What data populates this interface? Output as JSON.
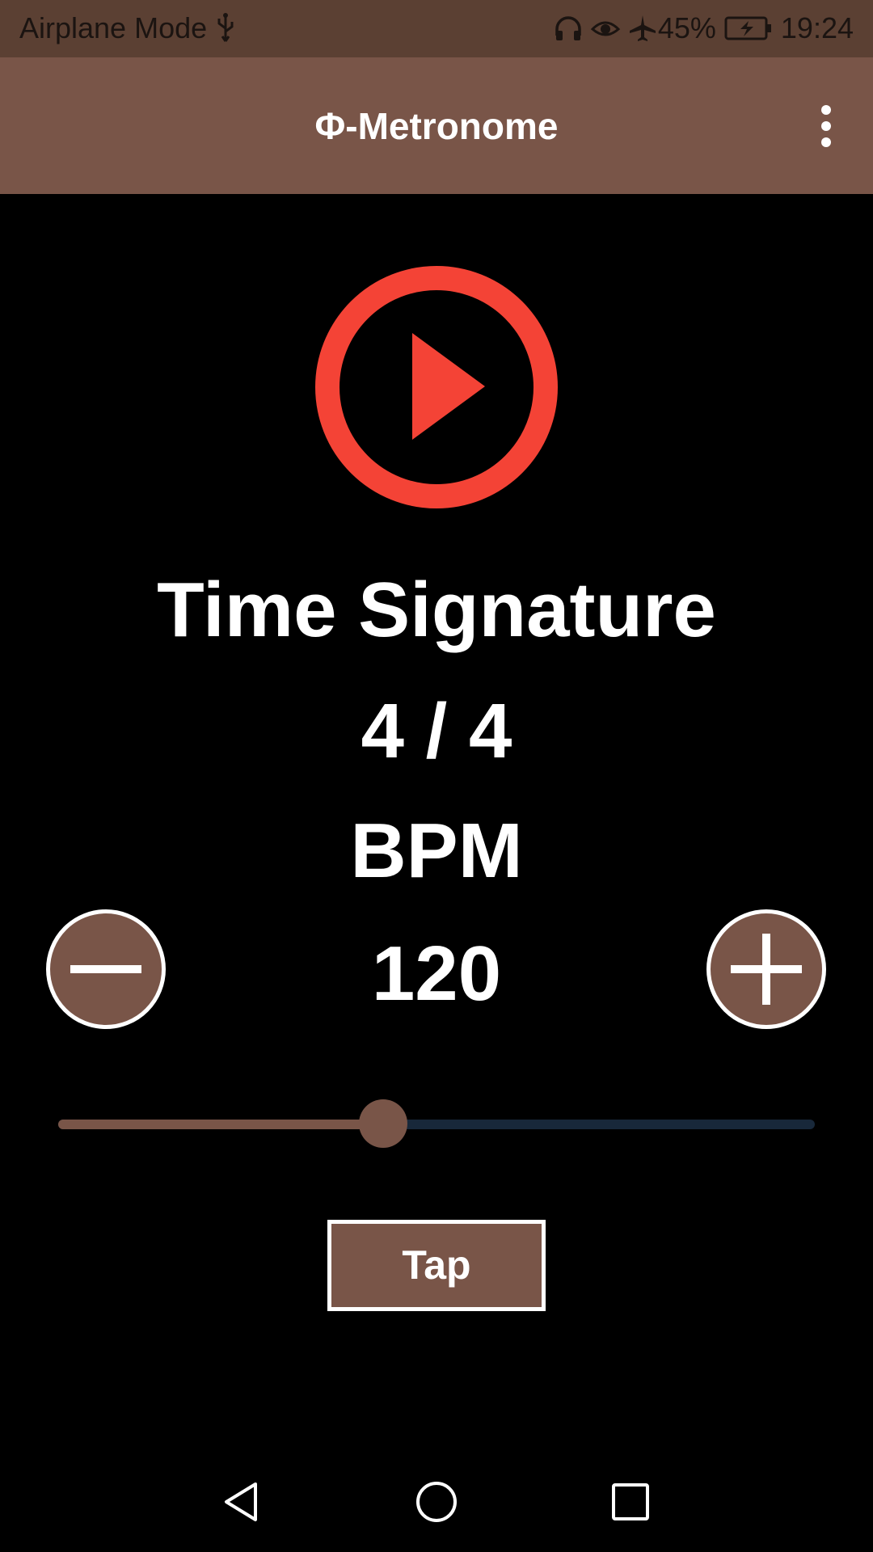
{
  "status_bar": {
    "left_text": "Airplane Mode",
    "battery_percent": "45%",
    "time": "19:24",
    "icons": [
      "usb-icon",
      "headphones-icon",
      "eye-icon",
      "airplane-icon",
      "battery-charging-icon"
    ]
  },
  "app_bar": {
    "title": "Φ-Metronome",
    "menu_icon": "more-vertical-icon"
  },
  "player": {
    "play_icon": "play-circle-icon",
    "accent_color": "#f44336"
  },
  "time_signature": {
    "label": "Time Signature",
    "value": "4 / 4"
  },
  "bpm": {
    "label": "BPM",
    "value": "120",
    "decrement_icon": "minus-icon",
    "increment_icon": "plus-icon"
  },
  "bpm_slider": {
    "fraction": 0.43
  },
  "tap_button": {
    "label": "Tap"
  },
  "nav_bar": {
    "icons": [
      "back-icon",
      "home-icon",
      "recents-icon"
    ]
  },
  "colors": {
    "primary": "#795548",
    "primary_dark": "#5b4033",
    "background": "#000000",
    "slider_track": "#18283a"
  }
}
